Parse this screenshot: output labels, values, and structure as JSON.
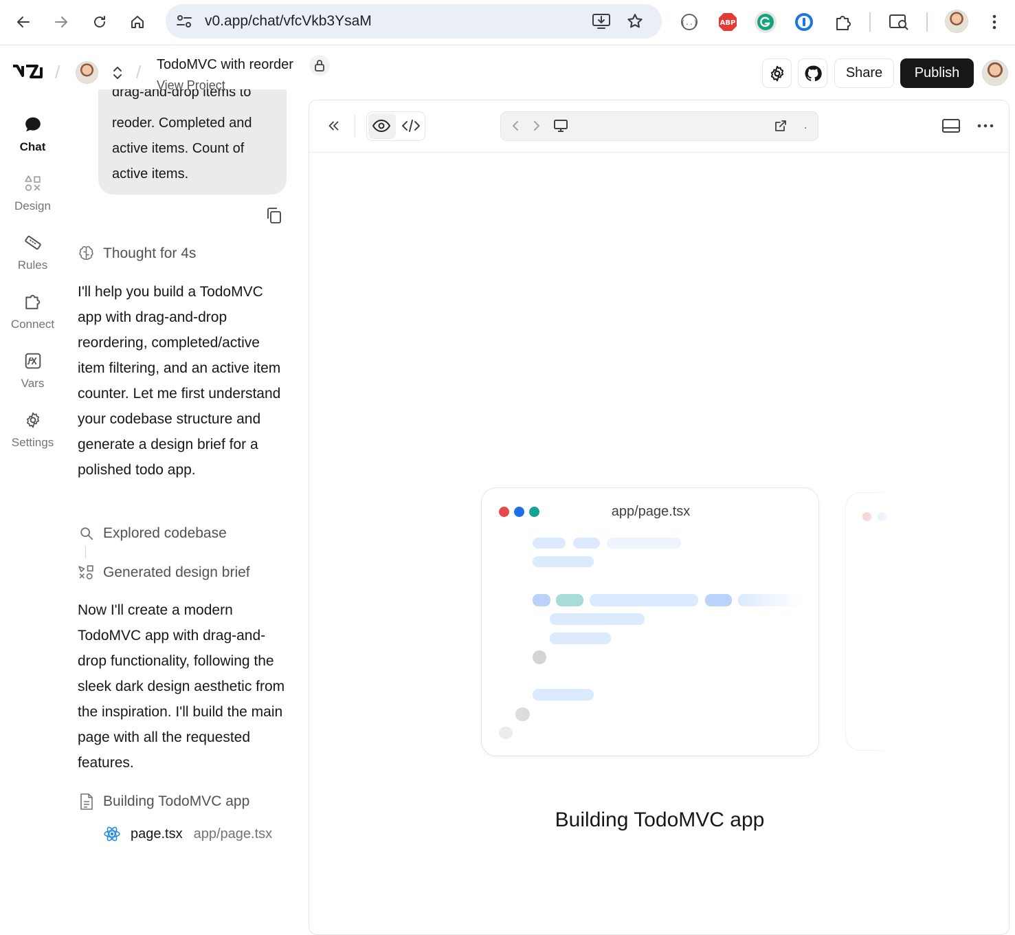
{
  "browser": {
    "url": "v0.app/chat/vfcVkb3YsaM",
    "ext_abp_label": "ABP"
  },
  "header": {
    "logo": "v0",
    "project_title": "TodoMVC with reorder",
    "project_sub": "View Project",
    "share_label": "Share",
    "publish_label": "Publish"
  },
  "rail": {
    "items": [
      {
        "label": "Chat",
        "icon": "chat-bubble-icon"
      },
      {
        "label": "Design",
        "icon": "design-shapes-icon"
      },
      {
        "label": "Rules",
        "icon": "ruler-icon"
      },
      {
        "label": "Connect",
        "icon": "plug-icon"
      },
      {
        "label": "Vars",
        "icon": "variable-icon"
      },
      {
        "label": "Settings",
        "icon": "gear-icon"
      }
    ]
  },
  "chat": {
    "user_message_cut": "drag-and-drop items to",
    "user_message": "reoder. Completed and active items. Count of active items.",
    "thought": "Thought for 4s",
    "para1": "I'll help you build a TodoMVC app with drag-and-drop reordering, completed/active item filtering, and an active item counter. Let me first understand your codebase structure and generate a design brief for a polished todo app.",
    "step_explored": "Explored codebase",
    "step_brief": "Generated design brief",
    "para2": "Now I'll create a modern TodoMVC app with drag-and-drop functionality, following the sleek dark design aesthetic from the inspiration. I'll build the main page with all the requested features.",
    "step_building": "Building TodoMVC app",
    "file_name": "page.tsx",
    "file_path": "app/page.tsx"
  },
  "preview": {
    "card_filename": "app/page.tsx",
    "status": "Building TodoMVC app",
    "address_value": "."
  }
}
